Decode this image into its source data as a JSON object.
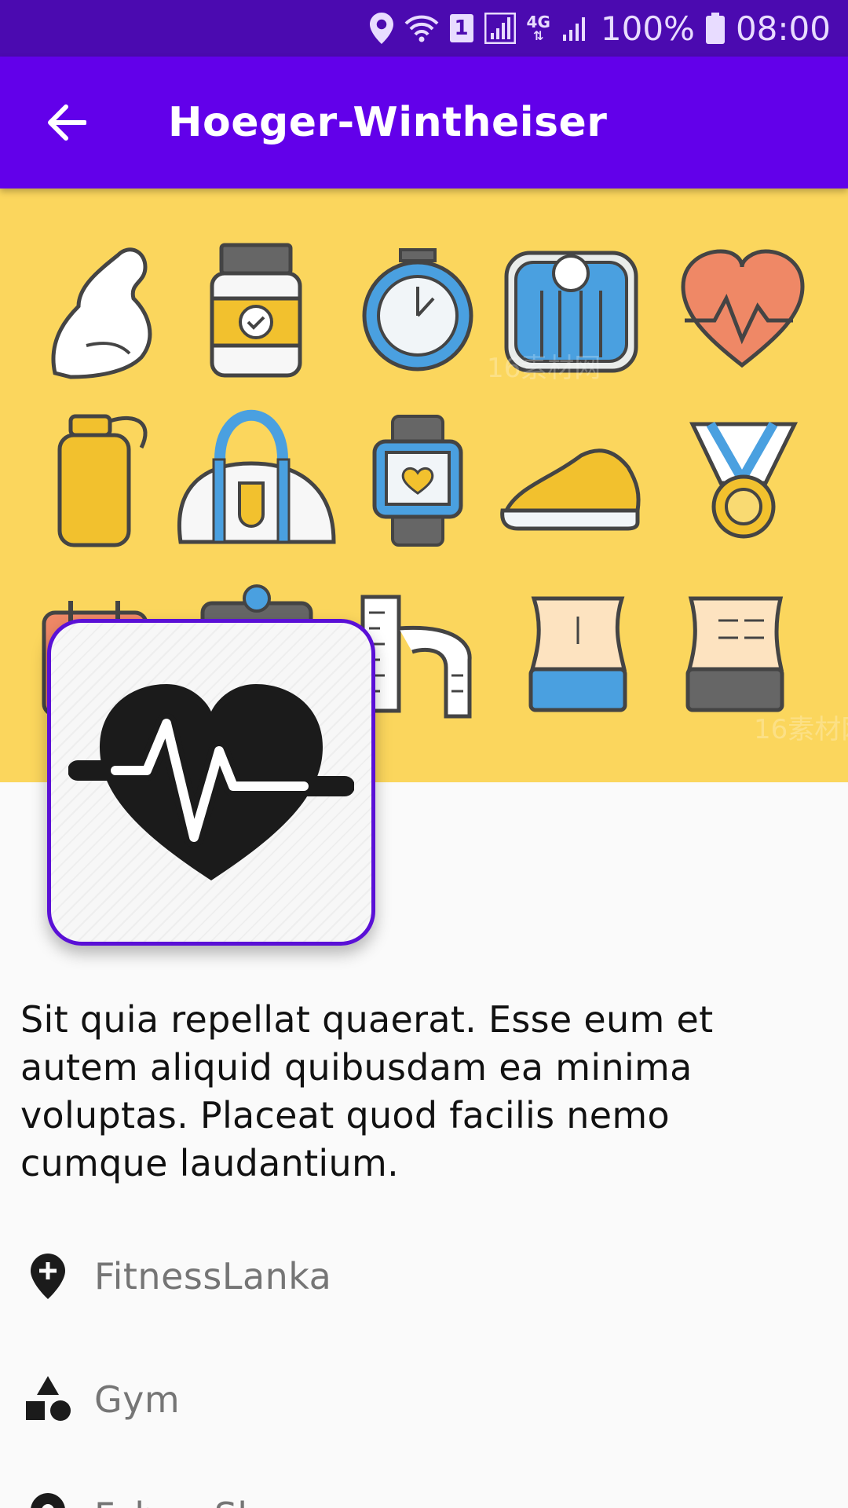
{
  "status_bar": {
    "sim_badge": "1",
    "network": "4G",
    "battery": "100%",
    "time": "08:00",
    "icons": [
      "location-icon",
      "wifi-icon",
      "sim-badge",
      "signal-icon",
      "network-4g",
      "signal-icon-2",
      "battery-icon"
    ]
  },
  "app_bar": {
    "back_icon": "arrow-back-icon",
    "title": "Hoeger-Wintheiser"
  },
  "hero": {
    "background_color": "#fbd65d",
    "watermark": "16素材网",
    "icons": [
      "bicep-icon",
      "supplement-jar-icon",
      "stopwatch-icon",
      "scale-icon",
      "heart-rate-icon",
      "water-bottle-icon",
      "gym-bag-icon",
      "smartwatch-icon",
      "sneaker-icon",
      "medal-icon",
      "calendar-icon",
      "clipboard-icon",
      "measuring-tape-icon",
      "waist-icon",
      "abs-icon"
    ]
  },
  "avatar": {
    "icon": "heart-pulse-icon",
    "border_color": "#5a10d6"
  },
  "description": "Sit quia repellat quaerat. Esse eum et autem aliquid quibusdam ea minima voluptas. Placeat quod facilis nemo cumque laudantium.",
  "details": [
    {
      "icon": "add-location-icon",
      "label": "FitnessLanka"
    },
    {
      "icon": "category-icon",
      "label": "Gym"
    },
    {
      "icon": "location-icon",
      "label": "Fahey Skyway"
    }
  ],
  "colors": {
    "status_bar": "#4b0ab0",
    "app_bar": "#6200ea",
    "background": "#fafafa"
  }
}
